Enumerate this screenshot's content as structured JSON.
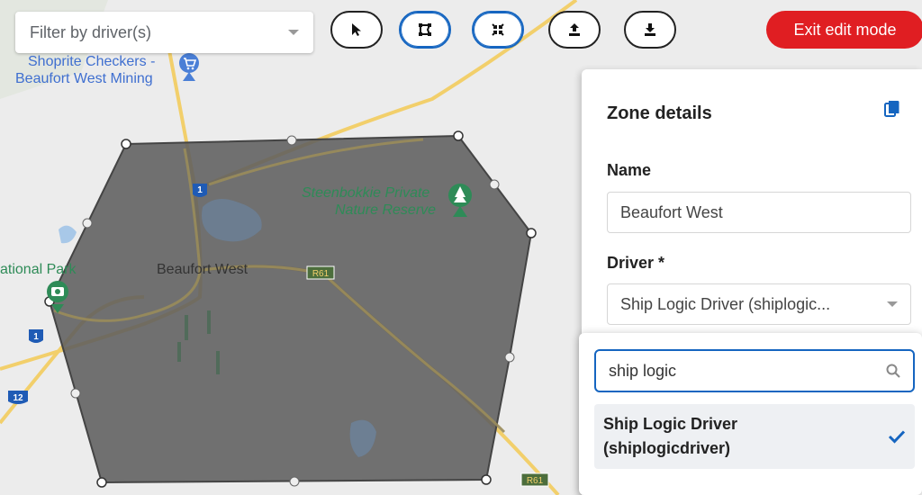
{
  "toolbar": {
    "filter_placeholder": "Filter by driver(s)",
    "tools": [
      {
        "name": "select-tool",
        "icon": "cursor-icon",
        "active": false
      },
      {
        "name": "draw-polygon-tool",
        "icon": "polygon-icon",
        "active": true
      },
      {
        "name": "collapse-tool",
        "icon": "collapse-icon",
        "active": true
      },
      {
        "name": "upload-tool",
        "icon": "upload-icon",
        "active": false
      },
      {
        "name": "download-tool",
        "icon": "download-icon",
        "active": false
      }
    ],
    "exit_label": "Exit edit mode"
  },
  "map": {
    "labels": {
      "shoprite_line1": "Shoprite Checkers -",
      "shoprite_line2": "Beaufort West Mining",
      "reserve_line1": "Steenbokkie Private",
      "reserve_line2": "Nature Reserve",
      "town": "Beaufort West",
      "park": "ational Park"
    },
    "route_shields": {
      "n1_top": "1",
      "n1_left": "1",
      "n12": "12",
      "r61_mid": "R61",
      "r61_bottom": "R61"
    },
    "zone_color": "#5f5f5f",
    "road_color": "#f2cf6b",
    "poi_color": "#2e8b57",
    "shop_color": "#4a7fd6"
  },
  "panel": {
    "title": "Zone details",
    "name_label": "Name",
    "name_value": "Beaufort West",
    "driver_label": "Driver *",
    "driver_value": "Ship Logic Driver (shiplogic..."
  },
  "dropdown": {
    "search_value": "ship logic",
    "option_line1": "Ship Logic Driver",
    "option_line2": "(shiplogicdriver)"
  },
  "colors": {
    "accent": "#1565c0",
    "danger": "#e01e22"
  }
}
